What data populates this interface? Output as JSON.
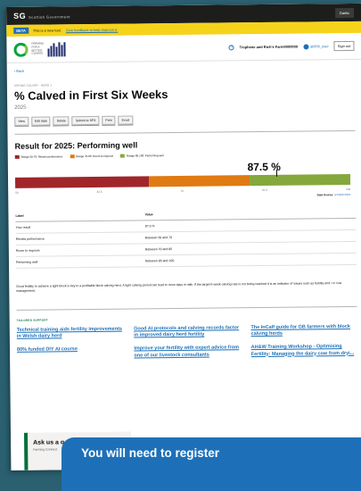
{
  "gov_bar": {
    "crest": "SG",
    "crest_sub": "Scottish Government",
    "right_label": "Gaelic"
  },
  "beta": {
    "tag": "BETA",
    "text": "This is a new tool.",
    "feedback": "Give feedback to help improve it."
  },
  "header": {
    "logo_text": "FARMING FOR A BETTER CLIMATE",
    "farm_name": "Trephene and Rich's Farm0000000",
    "user": "ali000_user",
    "sign_out": "Sign out"
  },
  "back": "Back",
  "caption": "SPRING CALVER · HERD 1",
  "title": "% Calved in First Six Weeks",
  "year": "2025",
  "actions": [
    "View",
    "Edit data",
    "Delete",
    "Submit to SFS",
    "Print",
    "Excel"
  ],
  "result": {
    "heading": "Result for 2025: Performing well",
    "legend": [
      "Range 50-70: Review performance",
      "Range 70-85: Room to improve",
      "Range 85-100: Performing well"
    ],
    "value_label": "87.5 %",
    "value": 87.5,
    "ticks": [
      "50",
      "62.5",
      "75",
      "87.5",
      "100"
    ],
    "source_label": "Data Source:",
    "source_value": "scVIEW 2024",
    "colors": {
      "review": "#a0262a",
      "improve": "#e07a12",
      "good": "#85a83c"
    }
  },
  "table": {
    "headers": [
      "Label",
      "Value"
    ],
    "rows": [
      [
        "Your result",
        "87.5 %"
      ],
      [
        "Review performance",
        "Between 50 and 70"
      ],
      [
        "Room to improve",
        "Between 70 and 85"
      ],
      [
        "Performing well",
        "Between 85 and 100"
      ]
    ]
  },
  "paragraph": "Good fertility to achieve a tight block is key to a profitable block calving herd. A tight calving period can lead to more days in milk. If the target 6 week calving rate is not being reached it is an indicator of issues such as fertility and / or cow management.",
  "support": {
    "label": "TAILORED SUPPORT",
    "links": [
      "Technical training aids fertility improvements in Welsh dairy herd",
      "Good AI protocols and calving records factor in improved dairy herd fertility",
      "The InCalf guide for GB farmers with block calving herds",
      "80% funded DIY AI course",
      "Improve your fertility with expert advice from one of our livestock consultants",
      "AH&W Training Workshop - Optimising Fertility: Managing the dairy cow from dryi..."
    ]
  },
  "ask": {
    "title": "Ask us a q",
    "subtitle": "Farming Connect"
  },
  "register": "You will need to register"
}
